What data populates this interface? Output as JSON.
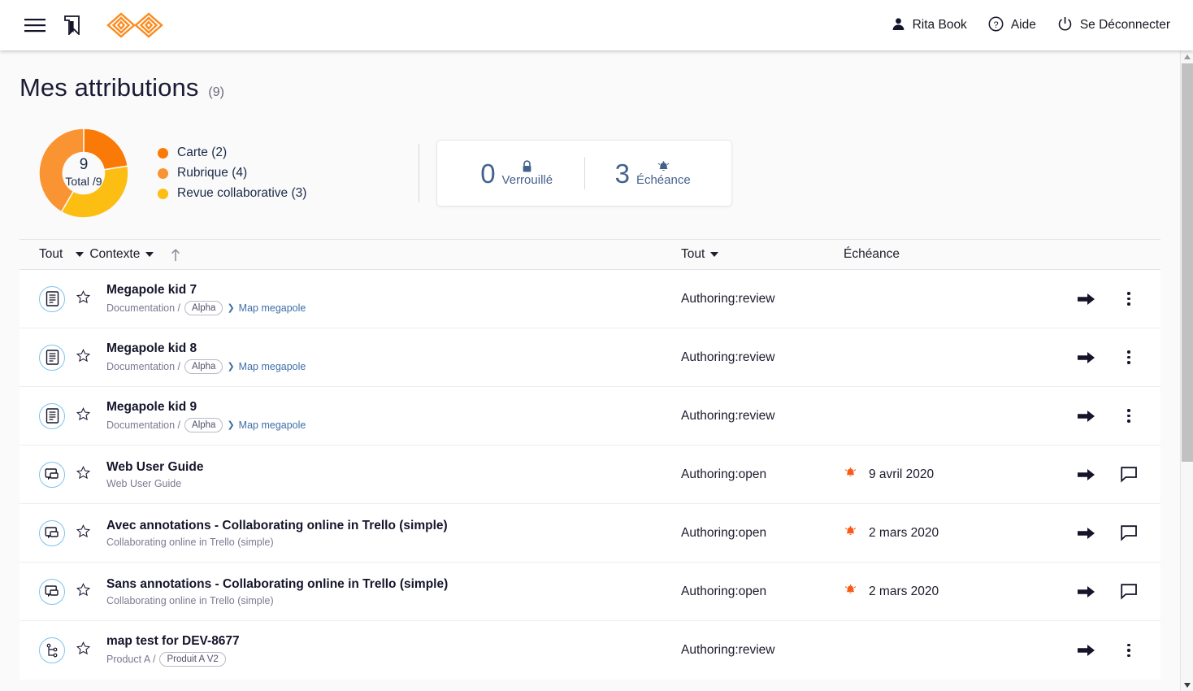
{
  "topbar": {
    "menu_icon": "hamburger-menu-icon",
    "bookmark_icon": "bookmark-icon",
    "logo_icon": "brand-logo-icon",
    "user_name": "Rita Book",
    "help_label": "Aide",
    "logout_label": "Se Déconnecter"
  },
  "header": {
    "title": "Mes attributions",
    "count": "(9)"
  },
  "chart_data": {
    "type": "pie",
    "title": "Mes attributions",
    "center_value": "9",
    "center_label": "Total /9",
    "total": 9,
    "categories": [
      "Carte",
      "Rubrique",
      "Revue collaborative"
    ],
    "values": [
      2,
      4,
      3
    ],
    "colors": [
      "#fa7a08",
      "#fa9332",
      "#fcbe13"
    ],
    "legend": [
      {
        "label": "Carte (2)",
        "color": "#fa7a08",
        "value": 2
      },
      {
        "label": "Rubrique (4)",
        "color": "#fa9332",
        "value": 4
      },
      {
        "label": "Revue collaborative (3)",
        "color": "#fcbe13",
        "value": 3
      }
    ],
    "legend_position": "right",
    "grid": false
  },
  "stats": [
    {
      "value": "0",
      "label": "Verrouillé",
      "icon": "lock-icon"
    },
    {
      "value": "3",
      "label": "Échéance",
      "icon": "bell-icon"
    }
  ],
  "table": {
    "headers": {
      "filter_all_context": "Tout",
      "context": "Contexte",
      "sort_icon": "sort-ascending-icon",
      "filter_all_status": "Tout",
      "due": "Échéance"
    },
    "rows": [
      {
        "icon": "document-icon",
        "title": "Megapole kid 7",
        "sub_prefix": "Documentation /",
        "sub_pill": "Alpha",
        "sub_link": "Map megapole",
        "status": "Authoring:review",
        "due": "",
        "due_icon": "",
        "action": "arrow-forward-icon",
        "secondary_action": "kebab-menu-icon"
      },
      {
        "icon": "document-icon",
        "title": "Megapole kid 8",
        "sub_prefix": "Documentation /",
        "sub_pill": "Alpha",
        "sub_link": "Map megapole",
        "status": "Authoring:review",
        "due": "",
        "due_icon": "",
        "action": "arrow-forward-icon",
        "secondary_action": "kebab-menu-icon"
      },
      {
        "icon": "document-icon",
        "title": "Megapole kid 9",
        "sub_prefix": "Documentation /",
        "sub_pill": "Alpha",
        "sub_link": "Map megapole",
        "status": "Authoring:review",
        "due": "",
        "due_icon": "",
        "action": "arrow-forward-icon",
        "secondary_action": "kebab-menu-icon"
      },
      {
        "icon": "review-comment-icon",
        "title": "Web User Guide",
        "sub_prefix": "Web User Guide",
        "sub_pill": "",
        "sub_link": "",
        "status": "Authoring:open",
        "due": "9 avril 2020",
        "due_icon": "bell-icon",
        "action": "arrow-forward-icon",
        "secondary_action": "comment-icon"
      },
      {
        "icon": "review-comment-icon",
        "title": "Avec annotations - Collaborating online in Trello (simple)",
        "sub_prefix": "Collaborating online in Trello (simple)",
        "sub_pill": "",
        "sub_link": "",
        "status": "Authoring:open",
        "due": "2 mars 2020",
        "due_icon": "bell-icon",
        "action": "arrow-forward-icon",
        "secondary_action": "comment-icon"
      },
      {
        "icon": "review-comment-icon",
        "title": "Sans annotations - Collaborating online in Trello (simple)",
        "sub_prefix": "Collaborating online in Trello (simple)",
        "sub_pill": "",
        "sub_link": "",
        "status": "Authoring:open",
        "due": "2 mars 2020",
        "due_icon": "bell-icon",
        "action": "arrow-forward-icon",
        "secondary_action": "comment-icon"
      },
      {
        "icon": "map-tree-icon",
        "title": "map test for DEV-8677",
        "sub_prefix": "Product A /",
        "sub_pill": "Produit A V2",
        "sub_link": "",
        "status": "Authoring:review",
        "due": "",
        "due_icon": "",
        "action": "arrow-forward-icon",
        "secondary_action": "kebab-menu-icon"
      }
    ]
  },
  "scrollbar": {
    "up_icon": "scroll-up-arrow-icon",
    "down_icon": "scroll-down-arrow-icon"
  }
}
